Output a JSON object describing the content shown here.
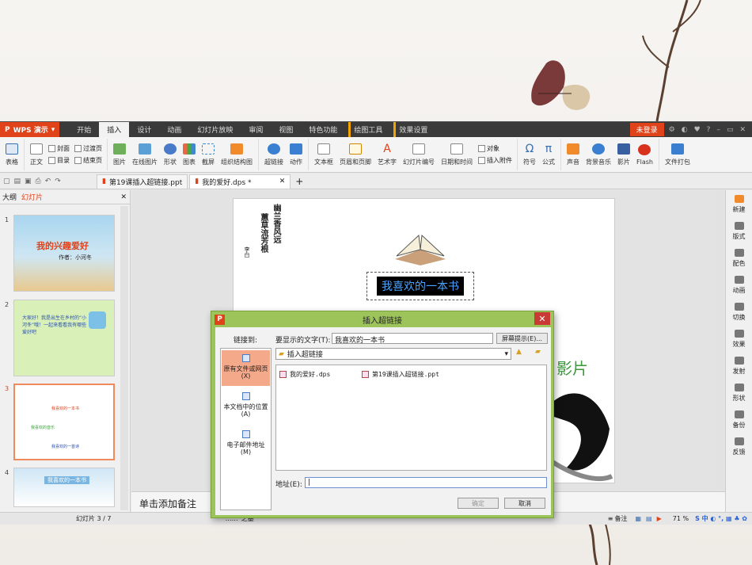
{
  "app": {
    "name": "WPS 演示",
    "menu_tabs": [
      "开始",
      "插入",
      "设计",
      "动画",
      "幻灯片放映",
      "审阅",
      "视图",
      "特色功能"
    ],
    "active_tab": "插入",
    "tool_tabs": [
      "绘图工具",
      "效果设置"
    ],
    "login_label": "未登录"
  },
  "ribbon": {
    "table": "表格",
    "body": "正文",
    "cover": "封面",
    "toc": "目录",
    "transition": "过渡页",
    "ending": "结束页",
    "picture": "图片",
    "online_picture": "在线图片",
    "shapes": "形状",
    "chart": "图表",
    "screenshot": "截屏",
    "smartart": "组织结构图",
    "hyperlink": "超链接",
    "action": "动作",
    "textbox": "文本框",
    "header_footer": "页眉和页脚",
    "wordart": "艺术字",
    "slide_number": "幻灯片编号",
    "datetime": "日期和时间",
    "object": "对象",
    "insert_attachment": "插入附件",
    "symbol": "符号",
    "formula": "公式",
    "sound": "声音",
    "bg_music": "背景音乐",
    "movie": "影片",
    "flash": "Flash",
    "pack": "文件打包"
  },
  "doc_tabs": [
    {
      "label": "第19课插入超链接.ppt",
      "active": false
    },
    {
      "label": "我的爱好.dps *",
      "active": true
    }
  ],
  "left_pane": {
    "tabs": [
      "大纲",
      "幻灯片"
    ],
    "active": "幻灯片",
    "thumbnails": [
      {
        "num": "1",
        "title": "我的兴趣爱好",
        "subtitle": "作者：小河冬"
      },
      {
        "num": "2",
        "text": "大家好！我是出生在乡村的“小河冬”哦！一起来看看我有哪些爱好吧"
      },
      {
        "num": "3",
        "caption1": "我喜欢的一本书",
        "caption2": "我喜欢的音乐",
        "caption3": "我喜欢的一首诗"
      },
      {
        "num": "4",
        "title": "我喜欢的一本书"
      }
    ]
  },
  "slide": {
    "poem": [
      "幽兰香风远",
      "蕙草流芳根"
    ],
    "author": "李白",
    "textbox": "我喜欢的一本书",
    "partial_text": "影片"
  },
  "notes_placeholder": "单击添加备注",
  "right_tools": [
    "新建",
    "版式",
    "配色",
    "动画",
    "切换",
    "效果",
    "发射",
    "形状",
    "备份",
    "反馈"
  ],
  "status": {
    "slide_counter": "幻灯片 3 / 7",
    "theme": "“……”之墨",
    "notes_label": "备注",
    "zoom": "71 %"
  },
  "dialog": {
    "title": "插入超链接",
    "link_to_label": "链接到:",
    "display_text_label": "要显示的文字(T):",
    "display_text_value": "我喜欢的一本书",
    "screentip_button": "屏幕提示(E)...",
    "folder": "插入超链接",
    "link_options": [
      {
        "label": "原有文件或网页(X)",
        "selected": true
      },
      {
        "label": "本文档中的位置(A)",
        "selected": false
      },
      {
        "label": "电子邮件地址(M)",
        "selected": false
      }
    ],
    "files": [
      "我的爱好.dps",
      "第19课插入超链接.ppt"
    ],
    "address_label": "地址(E):",
    "address_value": "|",
    "ok": "确定",
    "cancel": "取消"
  },
  "colors": {
    "accent": "#e0421a",
    "dialog_frame": "#9dc45b",
    "selected_option": "#f3a98a"
  }
}
